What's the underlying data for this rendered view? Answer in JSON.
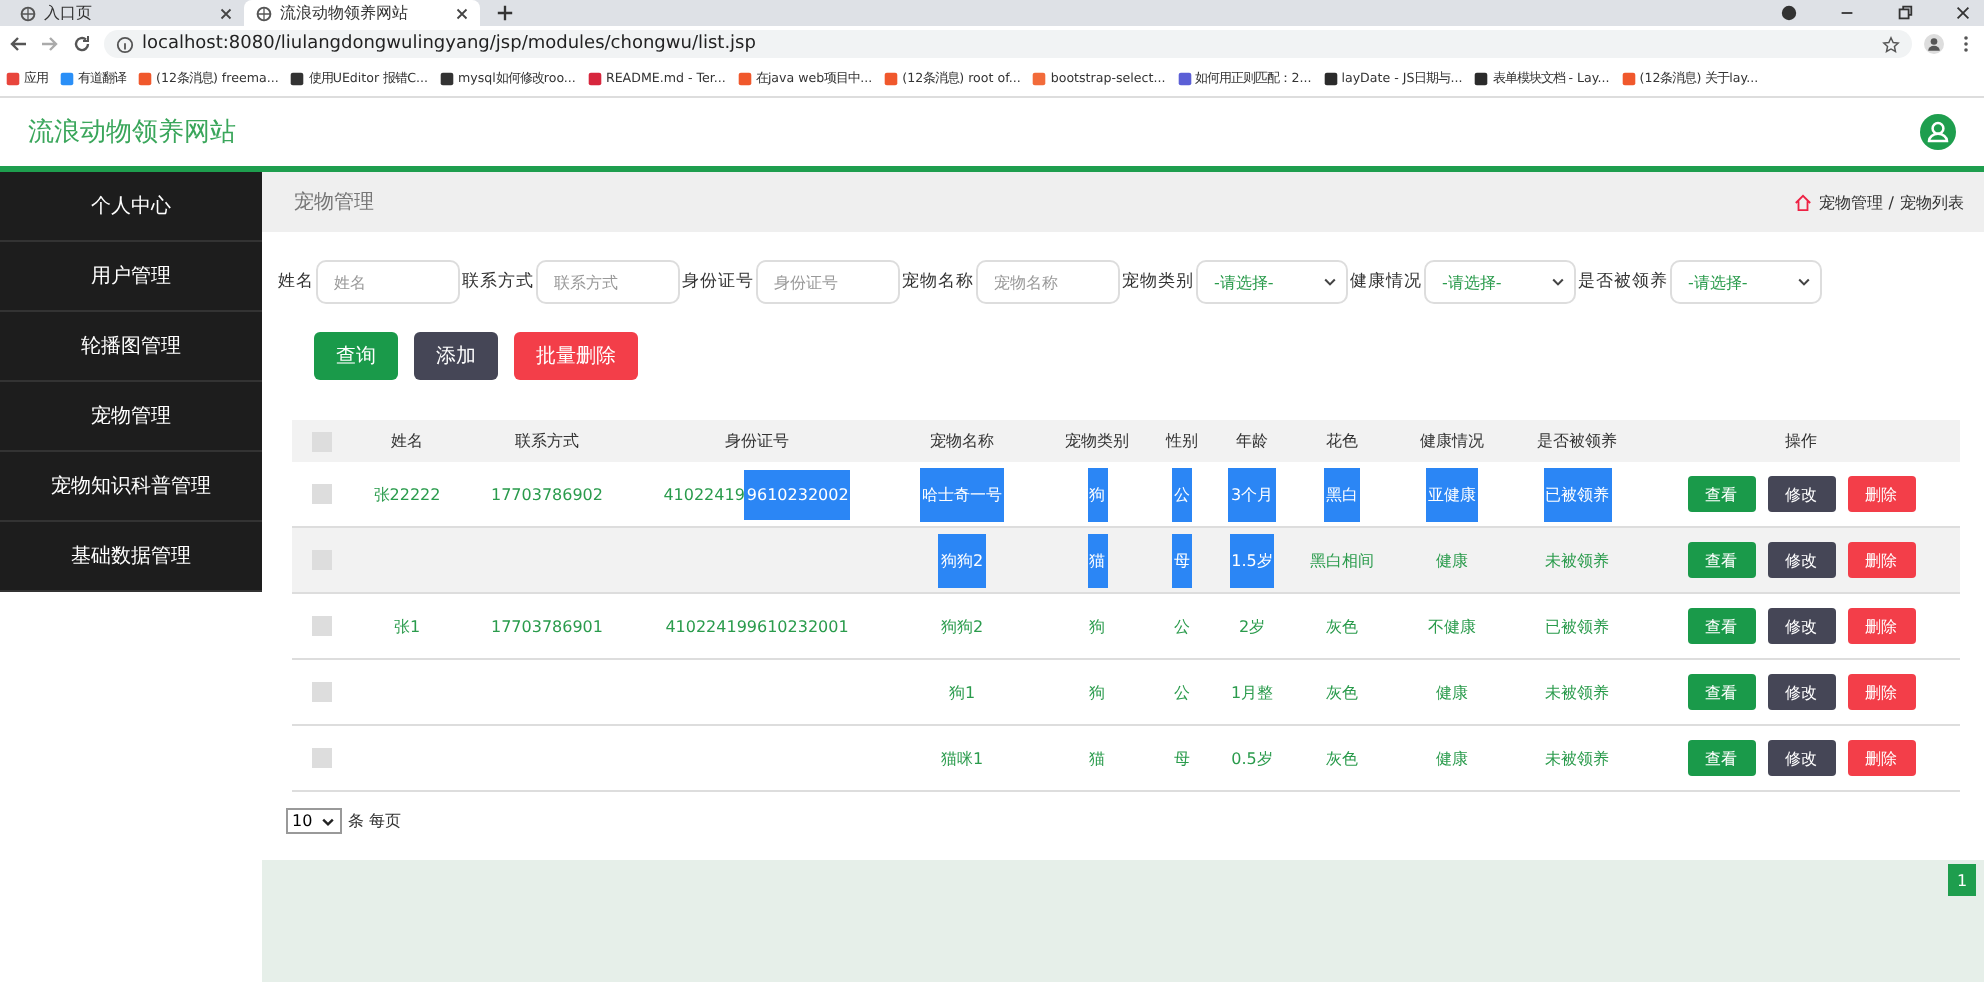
{
  "browser": {
    "tabs": [
      {
        "label": "入口页",
        "selected": false
      },
      {
        "label": "流浪动物领养网站",
        "selected": true
      }
    ],
    "url": "localhost:8080/liulangdongwulingyang/jsp/modules/chongwu/list.jsp",
    "bookmarks": [
      {
        "label": "应用",
        "color": "#e8453c"
      },
      {
        "label": "有道翻译",
        "color": "#2a8ff7"
      },
      {
        "label": "(12条消息) freema...",
        "color": "#f0582c"
      },
      {
        "label": "使用UEditor 报错C...",
        "color": "#333333"
      },
      {
        "label": "mysql如何修改roo...",
        "color": "#333333"
      },
      {
        "label": "README.md - Ter...",
        "color": "#d7263d"
      },
      {
        "label": "在java web项目中...",
        "color": "#f0582c"
      },
      {
        "label": "(12条消息) root of...",
        "color": "#f0582c"
      },
      {
        "label": "bootstrap-select...",
        "color": "#f26b3a"
      },
      {
        "label": "如何用正则匹配：2...",
        "color": "#5b5fd6"
      },
      {
        "label": "layDate - JS日期与...",
        "color": "#2b2b2b"
      },
      {
        "label": "表单模块文档 - Lay...",
        "color": "#2b2b2b"
      },
      {
        "label": "(12条消息) 关于lay...",
        "color": "#f0582c"
      }
    ]
  },
  "site_title": "流浪动物领养网站",
  "sidebar": {
    "items": [
      {
        "label": "个人中心",
        "selected": false
      },
      {
        "label": "用户管理",
        "selected": false
      },
      {
        "label": "轮播图管理",
        "selected": false
      },
      {
        "label": "宠物管理",
        "selected": false
      },
      {
        "label": "宠物知识科普管理",
        "selected": false
      },
      {
        "label": "基础数据管理",
        "selected": false
      }
    ]
  },
  "page_title": "宠物管理",
  "breadcrumb": [
    "宠物管理",
    "/",
    "宠物列表"
  ],
  "filters": [
    {
      "kind": "text",
      "label": "姓名",
      "placeholder": "姓名"
    },
    {
      "kind": "text",
      "label": "联系方式",
      "placeholder": "联系方式"
    },
    {
      "kind": "text",
      "label": "身份证号",
      "placeholder": "身份证号"
    },
    {
      "kind": "text",
      "label": "宠物名称",
      "placeholder": "宠物名称"
    },
    {
      "kind": "select",
      "label": "宠物类别",
      "value": "-请选择-"
    },
    {
      "kind": "select",
      "label": "健康情况",
      "value": "-请选择-"
    },
    {
      "kind": "select",
      "label": "是否被领养",
      "value": "-请选择-"
    }
  ],
  "buttons": [
    {
      "kind": "success",
      "label": "查询"
    },
    {
      "kind": "dark",
      "label": "添加"
    },
    {
      "kind": "danger",
      "label": "批量删除"
    }
  ],
  "table": {
    "header_checked": false,
    "columns": [
      "姓名",
      "联系方式",
      "身份证号",
      "宠物名称",
      "宠物类别",
      "性别",
      "年龄",
      "花色",
      "健康情况",
      "是否被领养",
      "操作"
    ],
    "rows": [
      {
        "hovered": false,
        "checked": false,
        "cells": [
          {
            "text": "张22222",
            "highlighted": false
          },
          {
            "text": "17703786902",
            "highlighted": false
          },
          {
            "before": "41022419",
            "text": "9610232002",
            "highlighted": true
          },
          {
            "text": "哈士奇一号",
            "highlighted": true
          },
          {
            "text": "狗",
            "highlighted": true
          },
          {
            "text": "公",
            "highlighted": true
          },
          {
            "text": "3个月",
            "highlighted": true
          },
          {
            "text": "黑白",
            "highlighted": true
          },
          {
            "text": "亚健康",
            "highlighted": true
          },
          {
            "text": "已被领养",
            "highlighted": true
          }
        ],
        "actions": [
          {
            "kind": "success",
            "label": "查看"
          },
          {
            "kind": "dark",
            "label": "修改"
          },
          {
            "kind": "danger",
            "label": "删除"
          }
        ]
      },
      {
        "hovered": true,
        "checked": false,
        "cells": [
          null,
          null,
          null,
          {
            "text": "狗狗2",
            "highlighted": true
          },
          {
            "text": "猫",
            "highlighted": true
          },
          {
            "text": "母",
            "highlighted": true
          },
          {
            "text": "1.5岁",
            "highlighted": true
          },
          {
            "text": "黑白相间",
            "highlighted": false
          },
          {
            "text": "健康",
            "highlighted": false
          },
          {
            "text": "未被领养",
            "highlighted": false
          }
        ],
        "actions": [
          {
            "kind": "success",
            "label": "查看"
          },
          {
            "kind": "dark",
            "label": "修改"
          },
          {
            "kind": "danger",
            "label": "删除"
          }
        ]
      },
      {
        "hovered": false,
        "checked": false,
        "cells": [
          {
            "text": "张1",
            "highlighted": false
          },
          {
            "text": "17703786901",
            "highlighted": false
          },
          {
            "text": "410224199610232001",
            "highlighted": false
          },
          {
            "text": "狗狗2",
            "highlighted": false
          },
          {
            "text": "狗",
            "highlighted": false
          },
          {
            "text": "公",
            "highlighted": false
          },
          {
            "text": "2岁",
            "highlighted": false
          },
          {
            "text": "灰色",
            "highlighted": false
          },
          {
            "text": "不健康",
            "highlighted": false
          },
          {
            "text": "已被领养",
            "highlighted": false
          }
        ],
        "actions": [
          {
            "kind": "success",
            "label": "查看"
          },
          {
            "kind": "dark",
            "label": "修改"
          },
          {
            "kind": "danger",
            "label": "删除"
          }
        ]
      },
      {
        "hovered": false,
        "checked": false,
        "cells": [
          null,
          null,
          null,
          {
            "text": "狗1",
            "highlighted": false
          },
          {
            "text": "狗",
            "highlighted": false
          },
          {
            "text": "公",
            "highlighted": false
          },
          {
            "text": "1月整",
            "highlighted": false
          },
          {
            "text": "灰色",
            "highlighted": false
          },
          {
            "text": "健康",
            "highlighted": false
          },
          {
            "text": "未被领养",
            "highlighted": false
          }
        ],
        "actions": [
          {
            "kind": "success",
            "label": "查看"
          },
          {
            "kind": "dark",
            "label": "修改"
          },
          {
            "kind": "danger",
            "label": "删除"
          }
        ]
      },
      {
        "hovered": false,
        "checked": false,
        "cells": [
          null,
          null,
          null,
          {
            "text": "猫咪1",
            "highlighted": false
          },
          {
            "text": "猫",
            "highlighted": false
          },
          {
            "text": "母",
            "highlighted": false
          },
          {
            "text": "0.5岁",
            "highlighted": false
          },
          {
            "text": "灰色",
            "highlighted": false
          },
          {
            "text": "健康",
            "highlighted": false
          },
          {
            "text": "未被领养",
            "highlighted": false
          }
        ],
        "actions": [
          {
            "kind": "success",
            "label": "查看"
          },
          {
            "kind": "dark",
            "label": "修改"
          },
          {
            "kind": "danger",
            "label": "删除"
          }
        ]
      }
    ]
  },
  "pagination": {
    "page_size": "10",
    "page_size_label": "条 每页",
    "pages": [
      {
        "label": "1",
        "selected": true
      }
    ]
  }
}
